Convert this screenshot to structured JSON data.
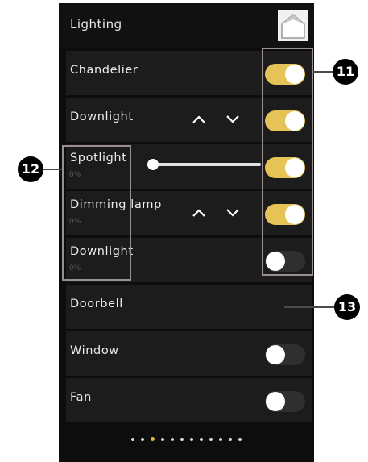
{
  "header": {
    "title": "Lighting"
  },
  "rows": [
    {
      "label": "Chandelier",
      "toggle": "on"
    },
    {
      "label": "Downlight",
      "toggle": "on"
    },
    {
      "label": "Spotlight",
      "sub": "0%",
      "toggle": "on",
      "slider_level": 0
    },
    {
      "label": "Dimming lamp",
      "sub": "0%",
      "toggle": "on"
    },
    {
      "label": "Downlight",
      "sub": "0%",
      "toggle": "off"
    },
    {
      "label": "Doorbell"
    },
    {
      "label": "Window",
      "toggle": "off"
    },
    {
      "label": "Fan",
      "toggle": "off"
    }
  ],
  "page_dots": {
    "count": 12,
    "active_index": 2
  },
  "callouts": {
    "toggles": "11",
    "labels": "12",
    "row": "13"
  },
  "colors": {
    "accent": "#e6c357",
    "background": "#0d0d0d",
    "row": "#1c1c1c"
  },
  "icons": {
    "home": "home-icon",
    "up": "chevron-up-icon",
    "down": "chevron-down-icon"
  }
}
